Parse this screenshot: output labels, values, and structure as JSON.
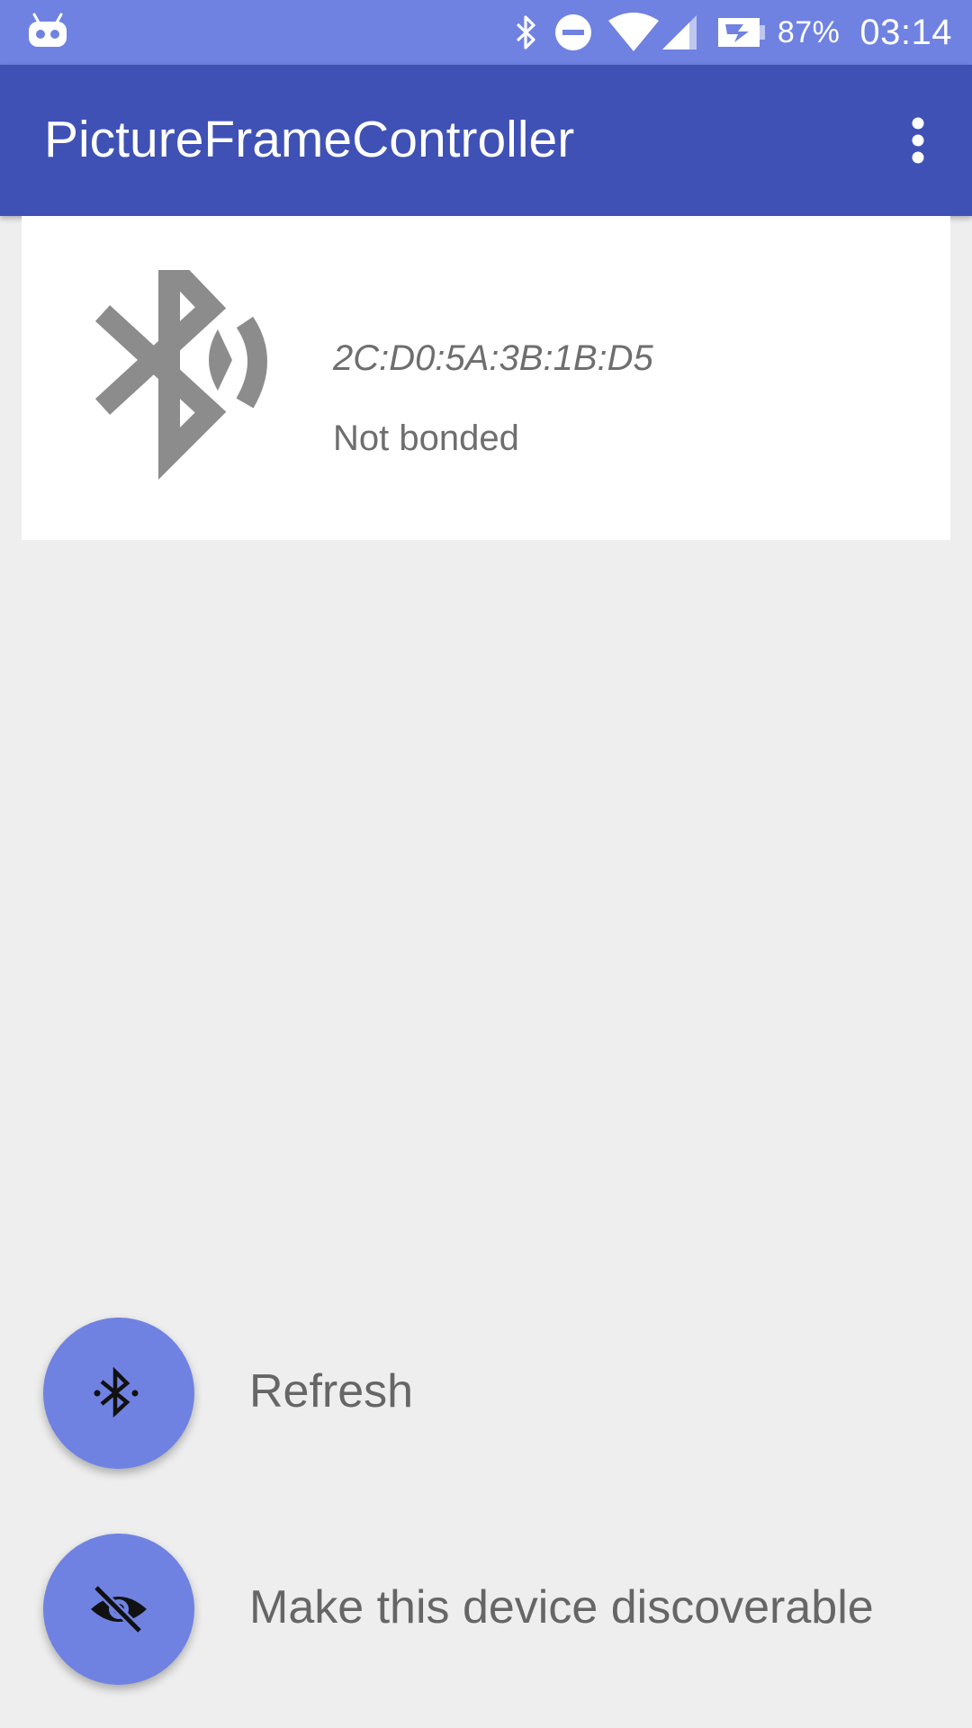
{
  "status_bar": {
    "left_icon": "android-robot-icon",
    "icons": [
      "bluetooth-icon",
      "do-not-disturb-icon",
      "wifi-icon",
      "cell-signal-icon",
      "battery-charging-icon"
    ],
    "battery_percent": "87%",
    "time": "03:14"
  },
  "app_bar": {
    "title": "PictureFrameController",
    "overflow_icon": "more-vert-icon"
  },
  "device": {
    "icon": "bluetooth-searching-icon",
    "mac_address": "2C:D0:5A:3B:1B:D5",
    "bond_state": "Not bonded"
  },
  "actions": [
    {
      "icon": "bluetooth-searching-icon",
      "label": "Refresh"
    },
    {
      "icon": "visibility-off-icon",
      "label": "Make this device discoverable"
    }
  ],
  "colors": {
    "status_bar": "#6f82e2",
    "app_bar": "#3f51b5",
    "fab": "#6f82e2",
    "background": "#eeeeee",
    "card": "#ffffff",
    "secondary_text": "#6e6e6e"
  }
}
